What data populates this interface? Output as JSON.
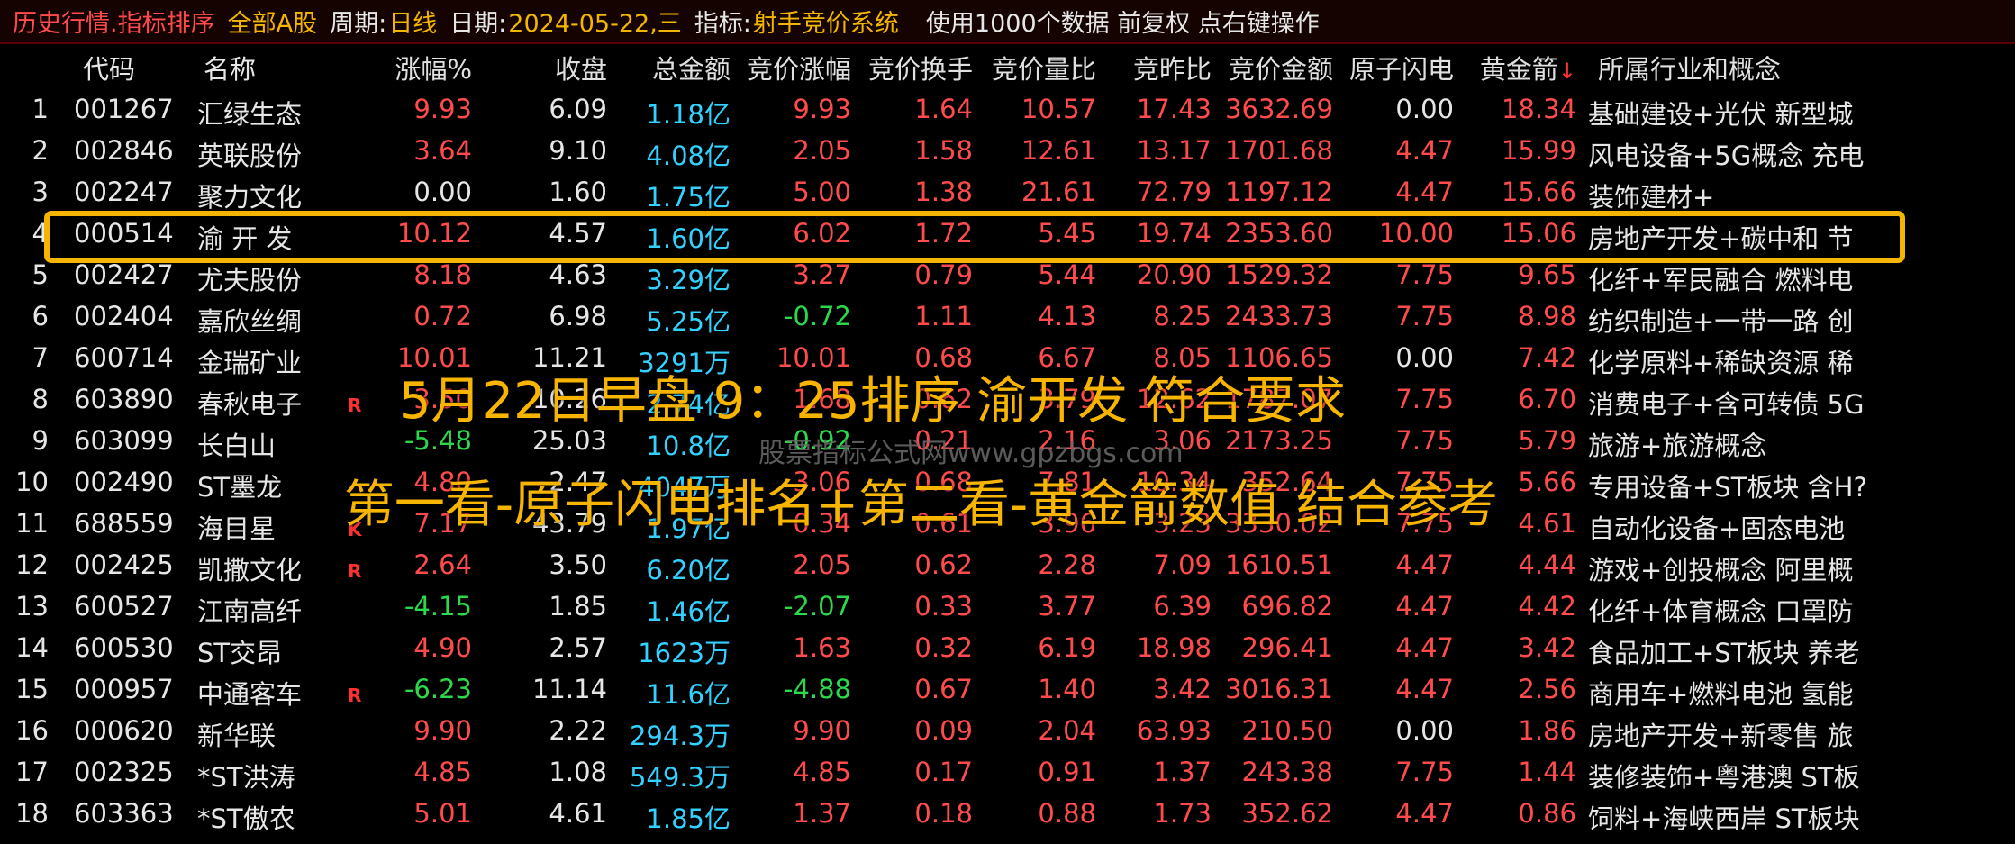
{
  "topbar": {
    "title": "历史行情.指标排序",
    "market": "全部A股",
    "period_label": "周期:",
    "period_value": "日线",
    "date_label": "日期:",
    "date_value": "2024-05-22,三",
    "indicator_label": "指标:",
    "indicator_value": "射手竞价系统",
    "info": "使用1000个数据 前复权 点右键操作"
  },
  "columns": [
    "代码",
    "名称",
    "涨幅%",
    "收盘",
    "总金额",
    "竞价涨幅",
    "竞价换手",
    "竞价量比",
    "竞昨比",
    "竞价金额",
    "原子闪电",
    "黄金箭",
    "所属行业和概念"
  ],
  "sort_indicator": "↓",
  "rows": [
    {
      "idx": "1",
      "code": "001267",
      "name": "汇绿生态",
      "flag": "",
      "chg": "9.93",
      "close": "6.09",
      "amt": "1.18亿",
      "bchg": "9.93",
      "turn": "1.64",
      "vratio": "10.57",
      "yratio": "17.43",
      "bamt": "3632.69",
      "atom": "0.00",
      "gold": "18.34",
      "ind": "基础建设+光伏 新型城",
      "chg_dir": "up",
      "bchg_dir": "up",
      "atom_dir": "flat"
    },
    {
      "idx": "2",
      "code": "002846",
      "name": "英联股份",
      "flag": "",
      "chg": "3.64",
      "close": "9.10",
      "amt": "4.08亿",
      "bchg": "2.05",
      "turn": "1.58",
      "vratio": "12.61",
      "yratio": "13.17",
      "bamt": "1701.68",
      "atom": "4.47",
      "gold": "15.99",
      "ind": "风电设备+5G概念 充电",
      "chg_dir": "up",
      "bchg_dir": "up",
      "atom_dir": "up"
    },
    {
      "idx": "3",
      "code": "002247",
      "name": "聚力文化",
      "flag": "",
      "chg": "0.00",
      "close": "1.60",
      "amt": "1.75亿",
      "bchg": "5.00",
      "turn": "1.38",
      "vratio": "21.61",
      "yratio": "72.79",
      "bamt": "1197.12",
      "atom": "4.47",
      "gold": "15.66",
      "ind": "装饰建材+",
      "chg_dir": "flat",
      "bchg_dir": "up",
      "atom_dir": "up"
    },
    {
      "idx": "4",
      "code": "000514",
      "name": "渝 开 发",
      "flag": "",
      "chg": "10.12",
      "close": "4.57",
      "amt": "1.60亿",
      "bchg": "6.02",
      "turn": "1.72",
      "vratio": "5.45",
      "yratio": "19.74",
      "bamt": "2353.60",
      "atom": "10.00",
      "gold": "15.06",
      "ind": "房地产开发+碳中和 节",
      "chg_dir": "up",
      "bchg_dir": "up",
      "atom_dir": "up"
    },
    {
      "idx": "5",
      "code": "002427",
      "name": "尤夫股份",
      "flag": "",
      "chg": "8.18",
      "close": "4.63",
      "amt": "3.29亿",
      "bchg": "3.27",
      "turn": "0.79",
      "vratio": "5.44",
      "yratio": "20.90",
      "bamt": "1529.32",
      "atom": "7.75",
      "gold": "9.65",
      "ind": "化纤+军民融合 燃料电",
      "chg_dir": "up",
      "bchg_dir": "up",
      "atom_dir": "up"
    },
    {
      "idx": "6",
      "code": "002404",
      "name": "嘉欣丝绸",
      "flag": "",
      "chg": "0.72",
      "close": "6.98",
      "amt": "5.25亿",
      "bchg": "-0.72",
      "turn": "1.11",
      "vratio": "4.13",
      "yratio": "8.25",
      "bamt": "2433.73",
      "atom": "7.75",
      "gold": "8.98",
      "ind": "纺织制造+一带一路 创",
      "chg_dir": "up",
      "bchg_dir": "down",
      "atom_dir": "up"
    },
    {
      "idx": "7",
      "code": "600714",
      "name": "金瑞矿业",
      "flag": "",
      "chg": "10.01",
      "close": "11.21",
      "amt": "3291万",
      "bchg": "10.01",
      "turn": "0.68",
      "vratio": "6.67",
      "yratio": "8.05",
      "bamt": "1106.65",
      "atom": "0.00",
      "gold": "7.42",
      "ind": "化学原料+稀缺资源 稀",
      "chg_dir": "up",
      "bchg_dir": "up",
      "atom_dir": "flat"
    },
    {
      "idx": "8",
      "code": "603890",
      "name": "春秋电子",
      "flag": "R",
      "chg": "3.50",
      "close": "10.26",
      "amt": "2.74亿",
      "bchg": "1.68",
      "turn": "0.62",
      "vratio": "3.79",
      "yratio": "12.62",
      "bamt": "1787.07",
      "atom": "7.75",
      "gold": "6.70",
      "ind": "消费电子+含可转债 5G",
      "chg_dir": "up",
      "bchg_dir": "up",
      "atom_dir": "up"
    },
    {
      "idx": "9",
      "code": "603099",
      "name": "长白山",
      "flag": "",
      "chg": "-5.48",
      "close": "25.03",
      "amt": "10.8亿",
      "bchg": "-0.92",
      "turn": "0.21",
      "vratio": "2.16",
      "yratio": "3.06",
      "bamt": "2173.25",
      "atom": "7.75",
      "gold": "5.79",
      "ind": "旅游+旅游概念",
      "chg_dir": "down",
      "bchg_dir": "down",
      "atom_dir": "up"
    },
    {
      "idx": "10",
      "code": "002490",
      "name": "ST墨龙",
      "flag": "",
      "chg": "4.80",
      "close": "2.47",
      "amt": "4047万",
      "bchg": "3.06",
      "turn": "0.68",
      "vratio": "7.81",
      "yratio": "10.34",
      "bamt": "352.64",
      "atom": "7.75",
      "gold": "5.66",
      "ind": "专用设备+ST板块 含H?",
      "chg_dir": "up",
      "bchg_dir": "up",
      "atom_dir": "up"
    },
    {
      "idx": "11",
      "code": "688559",
      "name": "海目星",
      "flag": "K",
      "chg": "7.17",
      "close": "43.79",
      "amt": "1.97亿",
      "bchg": "0.34",
      "turn": "0.61",
      "vratio": "3.96",
      "yratio": "3.23",
      "bamt": "3330.02",
      "atom": "7.75",
      "gold": "4.61",
      "ind": "自动化设备+固态电池",
      "chg_dir": "up",
      "bchg_dir": "up",
      "atom_dir": "up"
    },
    {
      "idx": "12",
      "code": "002425",
      "name": "凯撒文化",
      "flag": "R",
      "chg": "2.64",
      "close": "3.50",
      "amt": "6.20亿",
      "bchg": "2.05",
      "turn": "0.62",
      "vratio": "2.28",
      "yratio": "7.09",
      "bamt": "1610.51",
      "atom": "4.47",
      "gold": "4.44",
      "ind": "游戏+创投概念 阿里概",
      "chg_dir": "up",
      "bchg_dir": "up",
      "atom_dir": "up"
    },
    {
      "idx": "13",
      "code": "600527",
      "name": "江南高纤",
      "flag": "",
      "chg": "-4.15",
      "close": "1.85",
      "amt": "1.46亿",
      "bchg": "-2.07",
      "turn": "0.33",
      "vratio": "3.77",
      "yratio": "6.39",
      "bamt": "696.82",
      "atom": "4.47",
      "gold": "4.42",
      "ind": "化纤+体育概念 口罩防",
      "chg_dir": "down",
      "bchg_dir": "down",
      "atom_dir": "up"
    },
    {
      "idx": "14",
      "code": "600530",
      "name": "ST交昂",
      "flag": "",
      "chg": "4.90",
      "close": "2.57",
      "amt": "1623万",
      "bchg": "1.63",
      "turn": "0.32",
      "vratio": "6.19",
      "yratio": "18.98",
      "bamt": "296.41",
      "atom": "4.47",
      "gold": "3.42",
      "ind": "食品加工+ST板块 养老",
      "chg_dir": "up",
      "bchg_dir": "up",
      "atom_dir": "up"
    },
    {
      "idx": "15",
      "code": "000957",
      "name": "中通客车",
      "flag": "R",
      "chg": "-6.23",
      "close": "11.14",
      "amt": "11.6亿",
      "bchg": "-4.88",
      "turn": "0.67",
      "vratio": "1.40",
      "yratio": "3.42",
      "bamt": "3016.31",
      "atom": "4.47",
      "gold": "2.56",
      "ind": "商用车+燃料电池 氢能",
      "chg_dir": "down",
      "bchg_dir": "down",
      "atom_dir": "up"
    },
    {
      "idx": "16",
      "code": "000620",
      "name": "新华联",
      "flag": "",
      "chg": "9.90",
      "close": "2.22",
      "amt": "294.3万",
      "bchg": "9.90",
      "turn": "0.09",
      "vratio": "2.04",
      "yratio": "63.93",
      "bamt": "210.50",
      "atom": "0.00",
      "gold": "1.86",
      "ind": "房地产开发+新零售 旅",
      "chg_dir": "up",
      "bchg_dir": "up",
      "atom_dir": "flat"
    },
    {
      "idx": "17",
      "code": "002325",
      "name": "*ST洪涛",
      "flag": "",
      "chg": "4.85",
      "close": "1.08",
      "amt": "549.3万",
      "bchg": "4.85",
      "turn": "0.17",
      "vratio": "0.91",
      "yratio": "1.37",
      "bamt": "243.38",
      "atom": "7.75",
      "gold": "1.44",
      "ind": "装修装饰+粤港澳 ST板",
      "chg_dir": "up",
      "bchg_dir": "up",
      "atom_dir": "up"
    },
    {
      "idx": "18",
      "code": "603363",
      "name": "*ST傲农",
      "flag": "",
      "chg": "5.01",
      "close": "4.61",
      "amt": "1.85亿",
      "bchg": "1.37",
      "turn": "0.18",
      "vratio": "0.88",
      "yratio": "1.73",
      "bamt": "352.62",
      "atom": "4.47",
      "gold": "0.86",
      "ind": "饲料+海峡西岸 ST板块",
      "chg_dir": "up",
      "bchg_dir": "up",
      "atom_dir": "up"
    }
  ],
  "overlay": {
    "line1": "5月22日早盘 9：25排序 渝开发 符合要求",
    "line2": "第一看-原子闪电排名+第二看-黄金箭数值 结合参考",
    "watermark": "股票指标公式网www.gpzbgs.com"
  },
  "colors": {
    "up": "#ff4b4b",
    "down": "#2bd94a",
    "amount": "#33d1ff",
    "highlight": "#f5b400"
  }
}
